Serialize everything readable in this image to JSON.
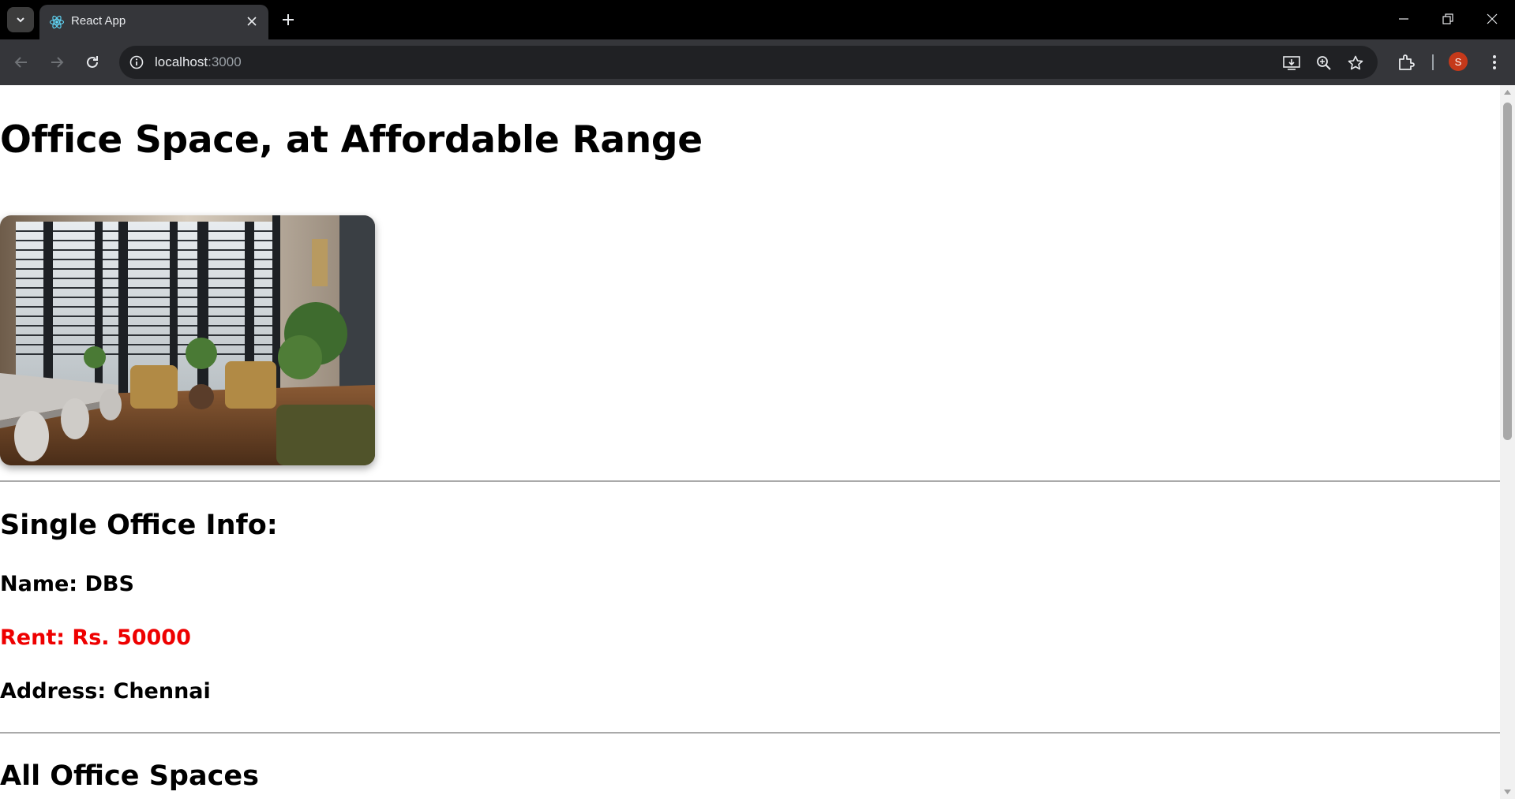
{
  "browser": {
    "tab_title": "React App",
    "url_host": "localhost",
    "url_port": ":3000",
    "profile_initial": "S",
    "accent_avatar": "#c5391a"
  },
  "icons": [
    "tab-search-icon",
    "react-icon",
    "close-icon",
    "plus-icon",
    "minimize-icon",
    "restore-icon",
    "window-close-icon",
    "back-icon",
    "forward-icon",
    "reload-icon",
    "info-icon",
    "install-icon",
    "zoom-icon",
    "star-icon",
    "extensions-icon",
    "kebab-menu-icon"
  ],
  "page": {
    "title": "Office Space, at Affordable Range",
    "single_heading": "Single Office Info:",
    "name_line": "Name: DBS",
    "rent_line": "Rent: Rs. 50000",
    "rent_color": "#ee0000",
    "address_line": "Address: Chennai",
    "all_heading": "All Office Spaces"
  }
}
